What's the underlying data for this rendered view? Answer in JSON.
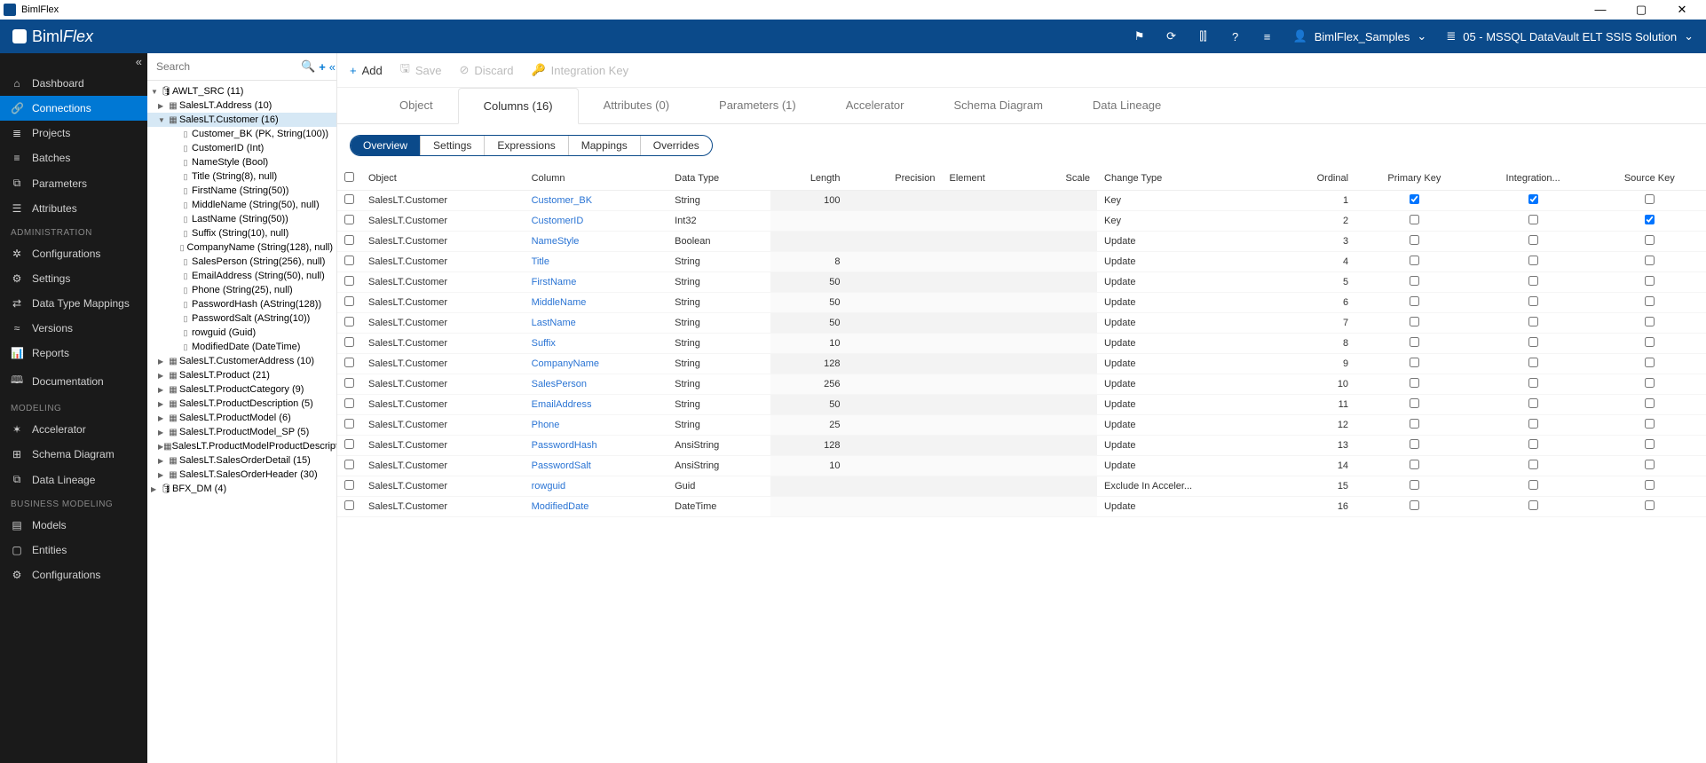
{
  "window_title": "BimlFlex",
  "brand": {
    "part1": "Biml",
    "part2": "Flex"
  },
  "project_selector": "BimlFlex_Samples",
  "solution_selector": "05 - MSSQL DataVault ELT SSIS Solution",
  "sidebar": {
    "items": [
      {
        "label": "Dashboard",
        "icon": "⌂"
      },
      {
        "label": "Connections",
        "icon": "🔗",
        "active": true
      },
      {
        "label": "Projects",
        "icon": "≣"
      },
      {
        "label": "Batches",
        "icon": "≡"
      },
      {
        "label": "Parameters",
        "icon": "⧉"
      },
      {
        "label": "Attributes",
        "icon": "☰"
      }
    ],
    "section_admin": "ADMINISTRATION",
    "admin": [
      {
        "label": "Configurations",
        "icon": "✲"
      },
      {
        "label": "Settings",
        "icon": "⚙"
      },
      {
        "label": "Data Type Mappings",
        "icon": "⇄"
      },
      {
        "label": "Versions",
        "icon": "≈"
      },
      {
        "label": "Reports",
        "icon": "📊"
      },
      {
        "label": "Documentation",
        "icon": "🕮"
      }
    ],
    "section_model": "MODELING",
    "model": [
      {
        "label": "Accelerator",
        "icon": "✶"
      },
      {
        "label": "Schema Diagram",
        "icon": "⊞"
      },
      {
        "label": "Data Lineage",
        "icon": "⧉"
      }
    ],
    "section_biz": "BUSINESS MODELING",
    "biz": [
      {
        "label": "Models",
        "icon": "▤"
      },
      {
        "label": "Entities",
        "icon": "▢"
      },
      {
        "label": "Configurations",
        "icon": "⚙"
      }
    ]
  },
  "search_placeholder": "Search",
  "tree": {
    "root": "AWLT_SRC (11)",
    "children": [
      {
        "label": "SalesLT.Address (10)"
      },
      {
        "label": "SalesLT.Customer (16)",
        "selected": true,
        "expanded": true,
        "columns": [
          "Customer_BK (PK, String(100))",
          "CustomerID (Int)",
          "NameStyle (Bool)",
          "Title (String(8), null)",
          "FirstName (String(50))",
          "MiddleName (String(50), null)",
          "LastName (String(50))",
          "Suffix (String(10), null)",
          "CompanyName (String(128), null)",
          "SalesPerson (String(256), null)",
          "EmailAddress (String(50), null)",
          "Phone (String(25), null)",
          "PasswordHash (AString(128))",
          "PasswordSalt (AString(10))",
          "rowguid (Guid)",
          "ModifiedDate (DateTime)"
        ]
      },
      {
        "label": "SalesLT.CustomerAddress (10)"
      },
      {
        "label": "SalesLT.Product (21)"
      },
      {
        "label": "SalesLT.ProductCategory (9)"
      },
      {
        "label": "SalesLT.ProductDescription (5)"
      },
      {
        "label": "SalesLT.ProductModel (6)"
      },
      {
        "label": "SalesLT.ProductModel_SP (5)"
      },
      {
        "label": "SalesLT.ProductModelProductDescripti..."
      },
      {
        "label": "SalesLT.SalesOrderDetail (15)"
      },
      {
        "label": "SalesLT.SalesOrderHeader (30)"
      }
    ],
    "root2": "BFX_DM (4)"
  },
  "toolbar": {
    "add": "Add",
    "save": "Save",
    "discard": "Discard",
    "ikey": "Integration Key"
  },
  "main_tabs": [
    "Object",
    "Columns (16)",
    "Attributes (0)",
    "Parameters (1)",
    "Accelerator",
    "Schema Diagram",
    "Data Lineage"
  ],
  "main_tab_active": 1,
  "sub_tabs": [
    "Overview",
    "Settings",
    "Expressions",
    "Mappings",
    "Overrides"
  ],
  "sub_tab_active": 0,
  "grid": {
    "headers": [
      "Object",
      "Column",
      "Data Type",
      "Length",
      "Precision",
      "Element",
      "Scale",
      "Change Type",
      "Ordinal",
      "Primary Key",
      "Integration...",
      "Source Key"
    ],
    "rows": [
      {
        "object": "SalesLT.Customer",
        "column": "Customer_BK",
        "dtype": "String",
        "len": "100",
        "change": "Key",
        "ord": "1",
        "pk": true,
        "ik": true,
        "sk": false
      },
      {
        "object": "SalesLT.Customer",
        "column": "CustomerID",
        "dtype": "Int32",
        "len": "",
        "change": "Key",
        "ord": "2",
        "pk": false,
        "ik": false,
        "sk": true
      },
      {
        "object": "SalesLT.Customer",
        "column": "NameStyle",
        "dtype": "Boolean",
        "len": "",
        "change": "Update",
        "ord": "3",
        "pk": false,
        "ik": false,
        "sk": false
      },
      {
        "object": "SalesLT.Customer",
        "column": "Title",
        "dtype": "String",
        "len": "8",
        "change": "Update",
        "ord": "4",
        "pk": false,
        "ik": false,
        "sk": false
      },
      {
        "object": "SalesLT.Customer",
        "column": "FirstName",
        "dtype": "String",
        "len": "50",
        "change": "Update",
        "ord": "5",
        "pk": false,
        "ik": false,
        "sk": false
      },
      {
        "object": "SalesLT.Customer",
        "column": "MiddleName",
        "dtype": "String",
        "len": "50",
        "change": "Update",
        "ord": "6",
        "pk": false,
        "ik": false,
        "sk": false
      },
      {
        "object": "SalesLT.Customer",
        "column": "LastName",
        "dtype": "String",
        "len": "50",
        "change": "Update",
        "ord": "7",
        "pk": false,
        "ik": false,
        "sk": false
      },
      {
        "object": "SalesLT.Customer",
        "column": "Suffix",
        "dtype": "String",
        "len": "10",
        "change": "Update",
        "ord": "8",
        "pk": false,
        "ik": false,
        "sk": false
      },
      {
        "object": "SalesLT.Customer",
        "column": "CompanyName",
        "dtype": "String",
        "len": "128",
        "change": "Update",
        "ord": "9",
        "pk": false,
        "ik": false,
        "sk": false
      },
      {
        "object": "SalesLT.Customer",
        "column": "SalesPerson",
        "dtype": "String",
        "len": "256",
        "change": "Update",
        "ord": "10",
        "pk": false,
        "ik": false,
        "sk": false
      },
      {
        "object": "SalesLT.Customer",
        "column": "EmailAddress",
        "dtype": "String",
        "len": "50",
        "change": "Update",
        "ord": "11",
        "pk": false,
        "ik": false,
        "sk": false
      },
      {
        "object": "SalesLT.Customer",
        "column": "Phone",
        "dtype": "String",
        "len": "25",
        "change": "Update",
        "ord": "12",
        "pk": false,
        "ik": false,
        "sk": false
      },
      {
        "object": "SalesLT.Customer",
        "column": "PasswordHash",
        "dtype": "AnsiString",
        "len": "128",
        "change": "Update",
        "ord": "13",
        "pk": false,
        "ik": false,
        "sk": false
      },
      {
        "object": "SalesLT.Customer",
        "column": "PasswordSalt",
        "dtype": "AnsiString",
        "len": "10",
        "change": "Update",
        "ord": "14",
        "pk": false,
        "ik": false,
        "sk": false
      },
      {
        "object": "SalesLT.Customer",
        "column": "rowguid",
        "dtype": "Guid",
        "len": "",
        "change": "Exclude In Acceler...",
        "ord": "15",
        "pk": false,
        "ik": false,
        "sk": false
      },
      {
        "object": "SalesLT.Customer",
        "column": "ModifiedDate",
        "dtype": "DateTime",
        "len": "",
        "change": "Update",
        "ord": "16",
        "pk": false,
        "ik": false,
        "sk": false
      }
    ]
  }
}
